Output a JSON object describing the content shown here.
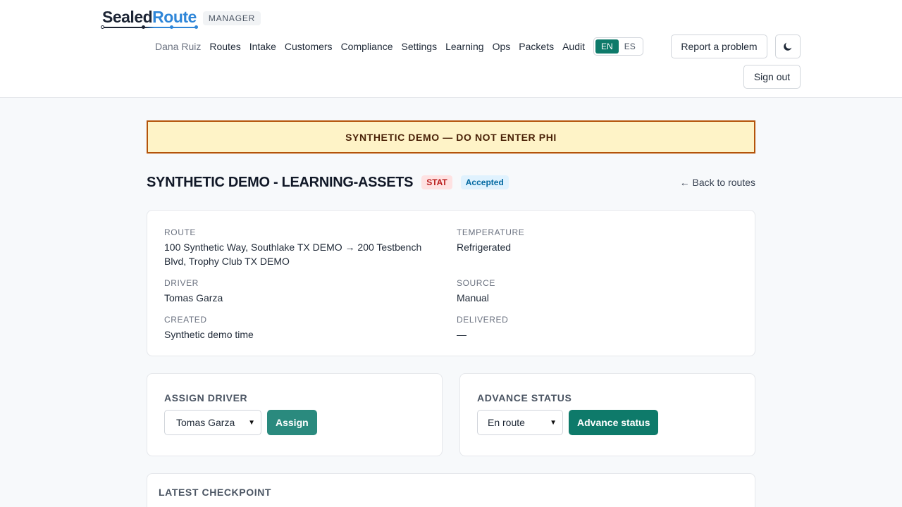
{
  "brand": {
    "logo_part1": "Sealed",
    "logo_part2": "Route",
    "role": "MANAGER"
  },
  "nav": {
    "user": "Dana Ruiz",
    "links": [
      "Routes",
      "Intake",
      "Customers",
      "Compliance",
      "Settings",
      "Learning",
      "Ops",
      "Packets",
      "Audit"
    ],
    "languages": [
      "EN",
      "ES"
    ],
    "active_language": "EN",
    "report_label": "Report a problem",
    "theme_icon": "moon-icon",
    "signout_label": "Sign out"
  },
  "banner": {
    "text": "SYNTHETIC DEMO — DO NOT ENTER PHI"
  },
  "page": {
    "title": "SYNTHETIC DEMO - LEARNING-ASSETS",
    "priority": "STAT",
    "status": "Accepted",
    "back_label": "← Back to routes"
  },
  "details": {
    "route_label": "ROUTE",
    "route_value": "100 Synthetic Way, Southlake TX DEMO → 200 Testbench Blvd, Trophy Club TX DEMO",
    "temperature_label": "TEMPERATURE",
    "temperature_value": "Refrigerated",
    "driver_label": "DRIVER",
    "driver_value": "Tomas Garza",
    "source_label": "SOURCE",
    "source_value": "Manual",
    "created_label": "CREATED",
    "created_value": "Synthetic demo time",
    "delivered_label": "DELIVERED",
    "delivered_value": "—"
  },
  "assign": {
    "title": "ASSIGN DRIVER",
    "selected": "Tomas Garza",
    "button": "Assign"
  },
  "advance": {
    "title": "ADVANCE STATUS",
    "selected": "En route",
    "button": "Advance status"
  },
  "checkpoint": {
    "title": "LATEST CHECKPOINT"
  },
  "colors": {
    "accent": "#0e7a6a",
    "banner_bg": "#fef3c7",
    "banner_border": "#b45309"
  }
}
